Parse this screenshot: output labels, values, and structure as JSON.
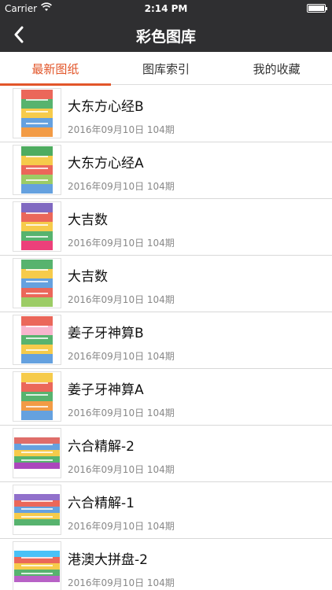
{
  "status_bar": {
    "carrier": "Carrier",
    "time": "2:14 PM"
  },
  "nav": {
    "title": "彩色图库"
  },
  "tabs": [
    {
      "label": "最新图纸",
      "active": true
    },
    {
      "label": "图库索引",
      "active": false
    },
    {
      "label": "我的收藏",
      "active": false
    }
  ],
  "items": [
    {
      "name": "大东方心经B",
      "meta": "2016年09月10日 104期",
      "thumb_colors": [
        "#e84c3d",
        "#3aa655",
        "#f4c22b",
        "#4a90d9",
        "#f08a24"
      ]
    },
    {
      "name": "大东方心经A",
      "meta": "2016年09月10日 104期",
      "thumb_colors": [
        "#2f9e44",
        "#f4c22b",
        "#e84c3d",
        "#8bc34a",
        "#4a90d9"
      ]
    },
    {
      "name": "大吉数",
      "meta": "2016年09月10日 104期",
      "thumb_colors": [
        "#6a4fb6",
        "#e84c3d",
        "#f4c22b",
        "#3aa655",
        "#e91e63"
      ]
    },
    {
      "name": "大吉数",
      "meta": "2016年09月10日 104期",
      "thumb_colors": [
        "#3aa655",
        "#f4c22b",
        "#4a90d9",
        "#e84c3d",
        "#8bc34a"
      ]
    },
    {
      "name": "姜子牙神算B",
      "meta": "2016年09月10日 104期",
      "thumb_colors": [
        "#e84c3d",
        "#f7a8c4",
        "#3aa655",
        "#f4c22b",
        "#4a90d9"
      ]
    },
    {
      "name": "姜子牙神算A",
      "meta": "2016年09月10日 104期",
      "thumb_colors": [
        "#f4c22b",
        "#e84c3d",
        "#3aa655",
        "#f08a24",
        "#4a90d9"
      ]
    },
    {
      "name": "六合精解-2",
      "meta": "2016年09月10日 104期",
      "thumb_colors": [
        "#d9534f",
        "#4a90d9",
        "#f4c22b",
        "#3aa655",
        "#9c27b0"
      ],
      "wide": true
    },
    {
      "name": "六合精解-1",
      "meta": "2016年09月10日 104期",
      "thumb_colors": [
        "#7e57c2",
        "#e84c3d",
        "#4a90d9",
        "#f4c22b",
        "#3aa655"
      ],
      "wide": true
    },
    {
      "name": "港澳大拼盘-2",
      "meta": "2016年09月10日 104期",
      "thumb_colors": [
        "#29b6f6",
        "#e84c3d",
        "#f4c22b",
        "#3aa655",
        "#ab47bc"
      ],
      "wide": true
    }
  ],
  "colors": {
    "bar_bg": "#2f2f31",
    "accent": "#e2562a",
    "meta_text": "#888888"
  },
  "icons": {
    "back": "chevron-left-icon",
    "wifi": "wifi-icon",
    "battery": "battery-icon"
  }
}
